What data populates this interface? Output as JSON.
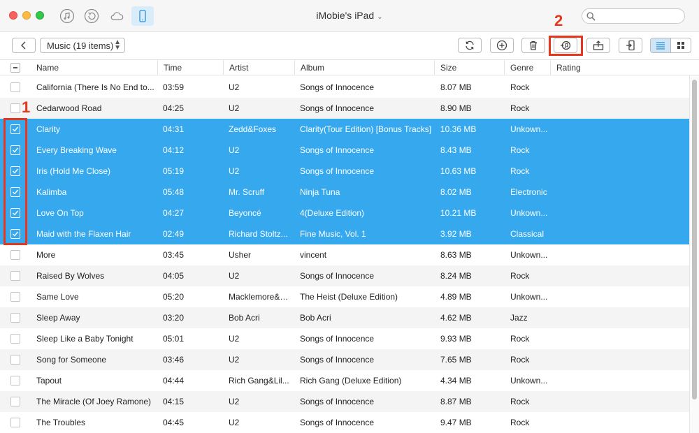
{
  "window": {
    "title": "iMobie's iPad"
  },
  "search": {
    "placeholder": ""
  },
  "toolbar": {
    "category_label": "Music (19 items)"
  },
  "annotations": {
    "marker_1": "1",
    "marker_2": "2"
  },
  "columns": [
    "Name",
    "Time",
    "Artist",
    "Album",
    "Size",
    "Genre",
    "Rating"
  ],
  "rows": [
    {
      "name": "California (There Is No End to...",
      "time": "03:59",
      "artist": "U2",
      "album": "Songs of Innocence",
      "size": "8.07 MB",
      "genre": "Rock",
      "checked": false
    },
    {
      "name": "Cedarwood Road",
      "time": "04:25",
      "artist": "U2",
      "album": "Songs of Innocence",
      "size": "8.90 MB",
      "genre": "Rock",
      "checked": false
    },
    {
      "name": "Clarity",
      "time": "04:31",
      "artist": "Zedd&Foxes",
      "album": "Clarity(Tour Edition) [Bonus Tracks]",
      "size": "10.36 MB",
      "genre": "Unkown...",
      "checked": true
    },
    {
      "name": "Every Breaking Wave",
      "time": "04:12",
      "artist": "U2",
      "album": "Songs of Innocence",
      "size": "8.43 MB",
      "genre": "Rock",
      "checked": true
    },
    {
      "name": "Iris (Hold Me Close)",
      "time": "05:19",
      "artist": "U2",
      "album": "Songs of Innocence",
      "size": "10.63 MB",
      "genre": "Rock",
      "checked": true
    },
    {
      "name": "Kalimba",
      "time": "05:48",
      "artist": "Mr. Scruff",
      "album": "Ninja Tuna",
      "size": "8.02 MB",
      "genre": "Electronic",
      "checked": true
    },
    {
      "name": "Love On Top",
      "time": "04:27",
      "artist": "Beyoncé",
      "album": "4(Deluxe Edition)",
      "size": "10.21 MB",
      "genre": "Unkown...",
      "checked": true
    },
    {
      "name": "Maid with the Flaxen Hair",
      "time": "02:49",
      "artist": "Richard Stoltz...",
      "album": "Fine Music, Vol. 1",
      "size": "3.92 MB",
      "genre": "Classical",
      "checked": true
    },
    {
      "name": "More",
      "time": "03:45",
      "artist": "Usher",
      "album": "vincent",
      "size": "8.63 MB",
      "genre": "Unkown...",
      "checked": false
    },
    {
      "name": "Raised By Wolves",
      "time": "04:05",
      "artist": "U2",
      "album": "Songs of Innocence",
      "size": "8.24 MB",
      "genre": "Rock",
      "checked": false
    },
    {
      "name": "Same Love",
      "time": "05:20",
      "artist": "Macklemore&R...",
      "album": "The Heist (Deluxe Edition)",
      "size": "4.89 MB",
      "genre": "Unkown...",
      "checked": false
    },
    {
      "name": "Sleep Away",
      "time": "03:20",
      "artist": "Bob Acri",
      "album": "Bob Acri",
      "size": "4.62 MB",
      "genre": "Jazz",
      "checked": false
    },
    {
      "name": "Sleep Like a Baby Tonight",
      "time": "05:01",
      "artist": "U2",
      "album": "Songs of Innocence",
      "size": "9.93 MB",
      "genre": "Rock",
      "checked": false
    },
    {
      "name": "Song for Someone",
      "time": "03:46",
      "artist": "U2",
      "album": "Songs of Innocence",
      "size": "7.65 MB",
      "genre": "Rock",
      "checked": false
    },
    {
      "name": "Tapout",
      "time": "04:44",
      "artist": "Rich Gang&Lil...",
      "album": "Rich Gang (Deluxe Edition)",
      "size": "4.34 MB",
      "genre": "Unkown...",
      "checked": false
    },
    {
      "name": "The Miracle (Of Joey Ramone)",
      "time": "04:15",
      "artist": "U2",
      "album": "Songs of Innocence",
      "size": "8.87 MB",
      "genre": "Rock",
      "checked": false
    },
    {
      "name": "The Troubles",
      "time": "04:45",
      "artist": "U2",
      "album": "Songs of Innocence",
      "size": "9.47 MB",
      "genre": "Rock",
      "checked": false
    }
  ],
  "colors": {
    "selection": "#36a8ed",
    "annotation": "#e5371d",
    "accent_tab": "#d9ecfa"
  },
  "icons": [
    "music-icon",
    "history-icon",
    "cloud-icon",
    "device-icon",
    "search-icon",
    "back-chevron-icon",
    "refresh-icon",
    "add-icon",
    "trash-icon",
    "to-itunes-icon",
    "export-icon",
    "send-to-device-icon",
    "list-view-icon",
    "grid-view-icon"
  ]
}
